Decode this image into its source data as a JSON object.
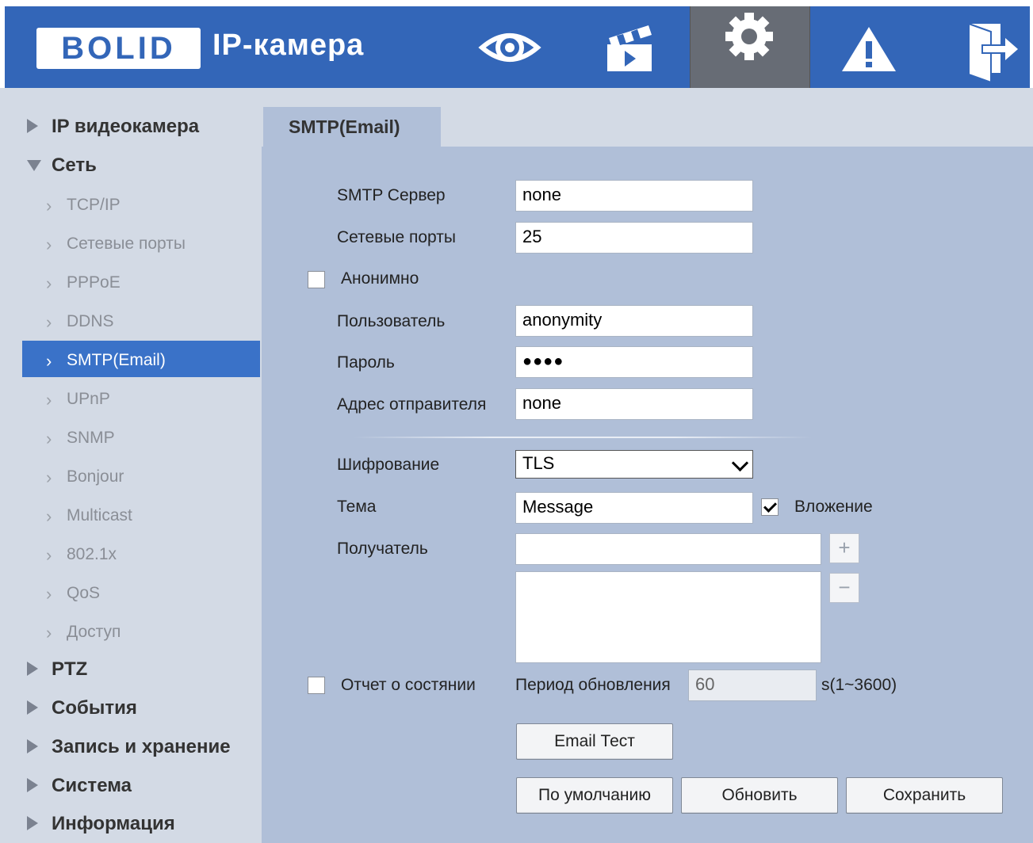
{
  "header": {
    "logo": "BOLID",
    "title": "IP-камера",
    "nav": [
      {
        "name": "live-view",
        "icon": "eye-icon"
      },
      {
        "name": "playback",
        "icon": "clapperboard-icon"
      },
      {
        "name": "settings",
        "icon": "gear-icon",
        "active": true
      },
      {
        "name": "alarm",
        "icon": "warning-icon"
      },
      {
        "name": "logout",
        "icon": "exit-icon"
      }
    ]
  },
  "sidebar": {
    "items": [
      {
        "label": "IP видеокамера",
        "level": 1,
        "expanded": false
      },
      {
        "label": "Сеть",
        "level": 1,
        "expanded": true
      },
      {
        "label": "TCP/IP",
        "level": 2
      },
      {
        "label": "Сетевые порты",
        "level": 2
      },
      {
        "label": "PPPoE",
        "level": 2
      },
      {
        "label": "DDNS",
        "level": 2
      },
      {
        "label": "SMTP(Email)",
        "level": 2,
        "active": true
      },
      {
        "label": "UPnP",
        "level": 2
      },
      {
        "label": "SNMP",
        "level": 2
      },
      {
        "label": "Bonjour",
        "level": 2
      },
      {
        "label": "Multicast",
        "level": 2
      },
      {
        "label": "802.1x",
        "level": 2
      },
      {
        "label": "QoS",
        "level": 2
      },
      {
        "label": "Доступ",
        "level": 2
      },
      {
        "label": "PTZ",
        "level": 1,
        "expanded": false
      },
      {
        "label": "События",
        "level": 1,
        "expanded": false
      },
      {
        "label": "Запись и хранение",
        "level": 1,
        "expanded": false
      },
      {
        "label": "Система",
        "level": 1,
        "expanded": false
      },
      {
        "label": "Информация",
        "level": 1,
        "expanded": false
      }
    ]
  },
  "tab": {
    "label": "SMTP(Email)"
  },
  "form": {
    "smtp_server": {
      "label": "SMTP Сервер",
      "value": "none"
    },
    "port": {
      "label": "Сетевые порты",
      "value": "25"
    },
    "anonymous": {
      "label": "Анонимно",
      "checked": false
    },
    "user": {
      "label": "Пользователь",
      "value": "anonymity"
    },
    "password": {
      "label": "Пароль",
      "value": "●●●●"
    },
    "sender": {
      "label": "Адрес отправителя",
      "value": "none"
    },
    "encryption": {
      "label": "Шифрование",
      "value": "TLS"
    },
    "subject": {
      "label": "Тема",
      "value": "Message"
    },
    "attachment": {
      "label": "Вложение",
      "checked": true
    },
    "recipient": {
      "label": "Получатель",
      "value": "",
      "add": "+",
      "remove": "−"
    },
    "status_report": {
      "label": "Отчет о состянии",
      "checked": false
    },
    "update_period": {
      "label": "Период обновления",
      "value": "60",
      "range": "s(1~3600)"
    }
  },
  "buttons": {
    "email_test": "Email Тест",
    "default": "По умолчанию",
    "refresh": "Обновить",
    "save": "Сохранить"
  }
}
